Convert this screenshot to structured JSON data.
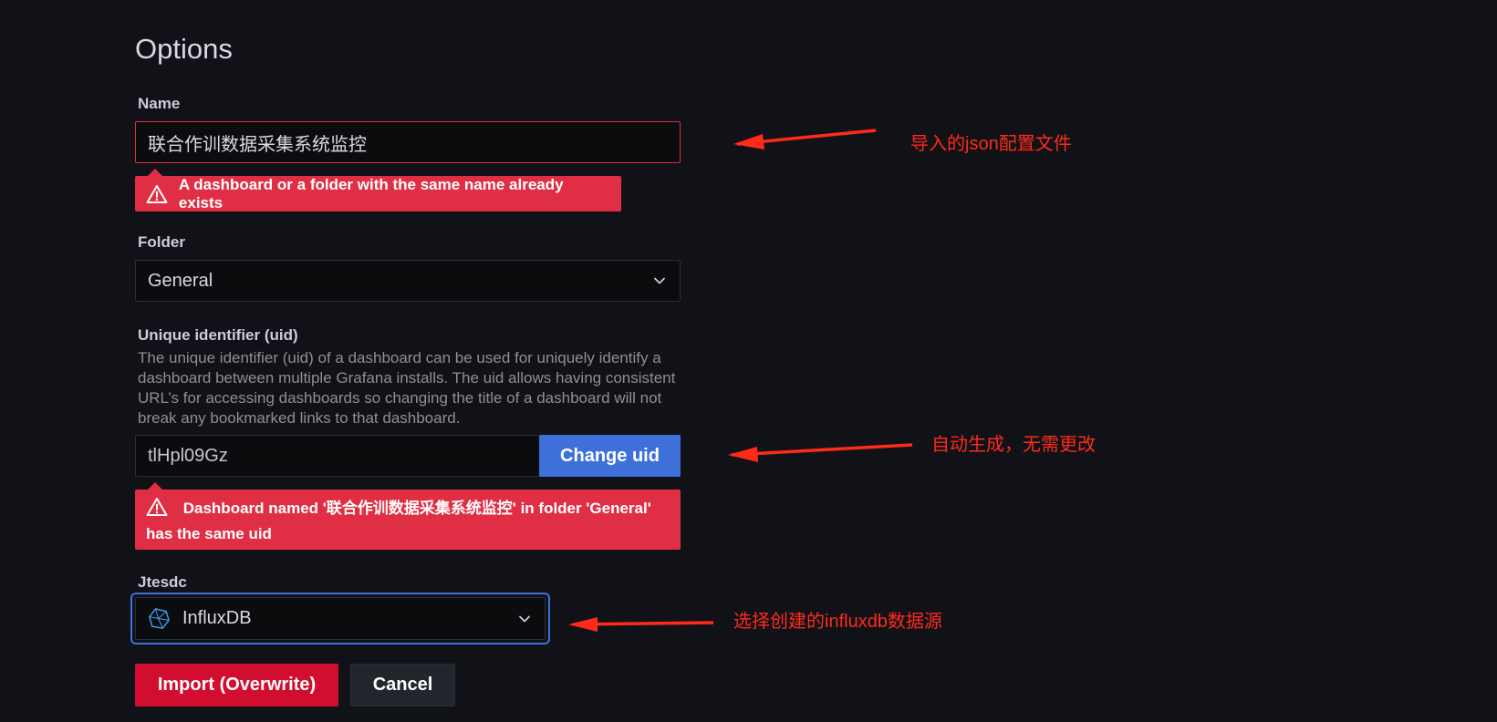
{
  "page_title": "Options",
  "name_field": {
    "label": "Name",
    "value": "联合作训数据采集系统监控",
    "error": "A dashboard or a folder with the same name already exists"
  },
  "folder_field": {
    "label": "Folder",
    "value": "General"
  },
  "uid_field": {
    "label": "Unique identifier (uid)",
    "description": "The unique identifier (uid) of a dashboard can be used for uniquely identify a dashboard between multiple Grafana installs. The uid allows having consistent URL’s for accessing dashboards so changing the title of a dashboard will not break any bookmarked links to that dashboard.",
    "value": "tlHpl09Gz",
    "change_button": "Change uid",
    "error": "Dashboard named '联合作训数据采集系统监控' in folder 'General' has the same uid"
  },
  "datasource_field": {
    "label": "Jtesdc",
    "value": "InfluxDB",
    "icon": "influxdb-icon"
  },
  "buttons": {
    "import": "Import (Overwrite)",
    "cancel": "Cancel"
  },
  "annotations": {
    "name_note": "导入的json配置文件",
    "uid_note": "自动生成，无需更改",
    "datasource_note": "选择创建的influxdb数据源"
  },
  "colors": {
    "error": "#e02f44",
    "primary": "#3d71d9",
    "annotation": "#ff2a1a"
  }
}
